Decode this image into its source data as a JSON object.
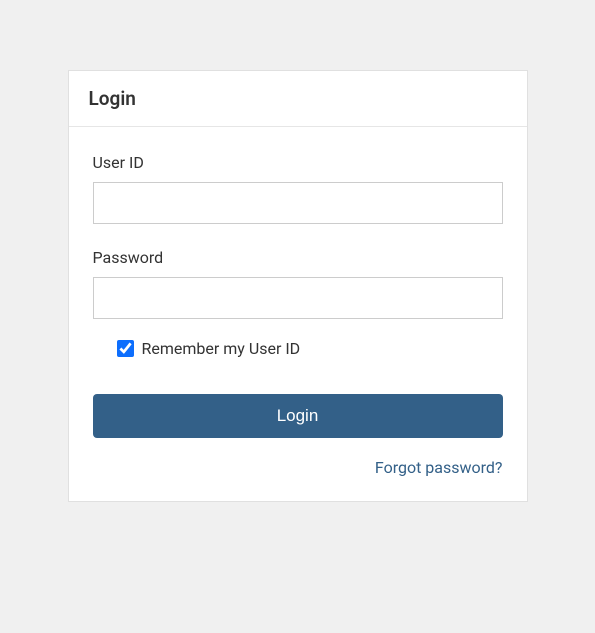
{
  "login": {
    "header_title": "Login",
    "user_id_label": "User ID",
    "user_id_value": "",
    "password_label": "Password",
    "password_value": "",
    "remember_label": "Remember my User ID",
    "remember_checked": true,
    "login_button_label": "Login",
    "forgot_password_label": "Forgot password?"
  }
}
